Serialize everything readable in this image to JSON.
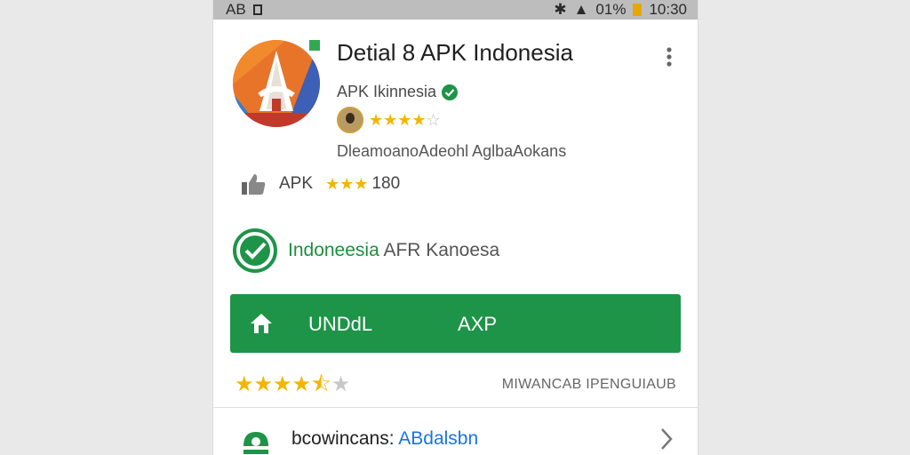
{
  "status_bar": {
    "left_text": "AB",
    "battery_text": "01%",
    "time": "10:30"
  },
  "app": {
    "title": "Detial 8 APK Indonesia",
    "developer": "APK Ikinnesia",
    "rating_stars": 4,
    "description": "DleamoanoAdeohl AglbaAokans",
    "apk_label": "APK",
    "apk_rating_count": "180",
    "apk_stars": 3
  },
  "verification": {
    "green_text": "Indoneesia",
    "gray_text": "AFR Kanoesa"
  },
  "install_button": {
    "label_left": "UNDdL",
    "label_right": "AXP",
    "color": "#1e9448"
  },
  "footer_rating": {
    "stars": 4.5,
    "meta": "MIWANCAB IPENGUIAUB"
  },
  "download_row": {
    "label": "bcowincans:",
    "value": "ABdalsbn"
  },
  "colors": {
    "accent_green": "#1e9448",
    "star": "#f2b600",
    "link_blue": "#1a73e8"
  },
  "icons": [
    "app-logo-icon",
    "more-vert-icon",
    "verified-icon",
    "avatar",
    "thumbs-up-icon",
    "check-circle-icon",
    "home-icon",
    "download-icon",
    "chevron-right-icon"
  ]
}
